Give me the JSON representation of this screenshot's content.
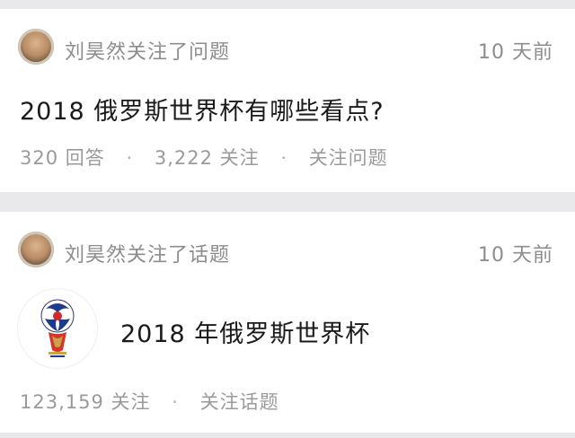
{
  "feed": [
    {
      "avatar_icon": "user-avatar-icon",
      "activity": "刘昊然关注了问题",
      "time": "10 天前",
      "title": "2018 俄罗斯世界杯有哪些看点?",
      "answers": "320 回答",
      "followers": "3,222 关注",
      "separator": "·",
      "action": "关注问题"
    },
    {
      "avatar_icon": "user-avatar-icon",
      "activity": "刘昊然关注了话题",
      "time": "10 天前",
      "topic_icon": "world-cup-trophy-icon",
      "title": "2018 年俄罗斯世界杯",
      "followers": "123,159 关注",
      "separator": "·",
      "action": "关注话题"
    }
  ],
  "colors": {
    "background": "#e9e9eb",
    "card": "#ffffff",
    "primary_text": "#1a1a1a",
    "secondary_text": "#8d8d8d"
  }
}
